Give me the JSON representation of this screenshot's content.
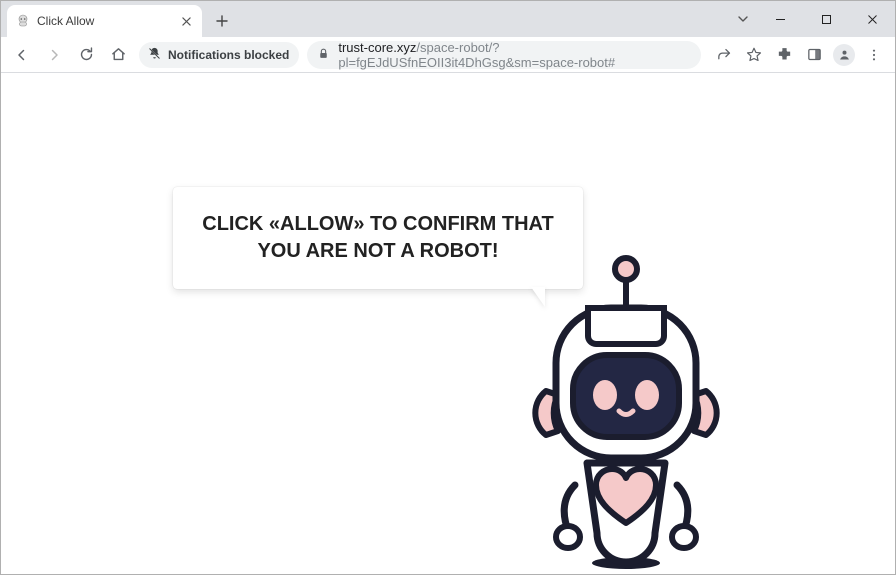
{
  "browser": {
    "tab_title": "Click Allow",
    "notification_chip": "Notifications blocked",
    "url_domain": "trust-core.xyz",
    "url_path": "/space-robot/?pl=fgEJdUSfnEOII3it4DhGsg&sm=space-robot#"
  },
  "page": {
    "message": "CLICK «ALLOW» TO CONFIRM THAT YOU ARE NOT A ROBOT!"
  }
}
